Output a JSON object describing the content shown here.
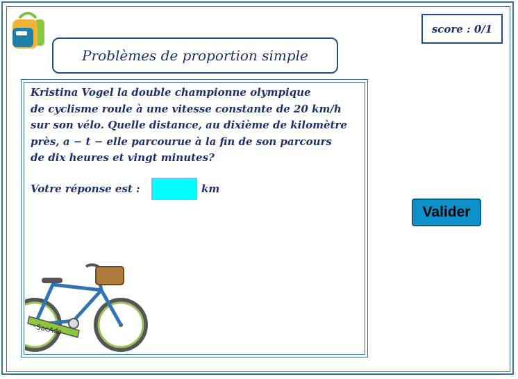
{
  "header": {
    "title": "Problèmes de proportion simple",
    "score": "score : 0/1"
  },
  "question": {
    "text": "Kristina Vogel la double championne olympique de cyclisme roule à une vitesse constante de 20 km/h sur son vélo. Quelle distance, au dixième de kilomètre près, a−t−elle parcourue à la fin de son parcours de dix heures et vingt minutes?",
    "lines": [
      "Kristina Vogel la double championne olympique",
      "de cyclisme roule à une vitesse constante de 20 km/h",
      "sur son vélo. Quelle distance, au dixième de kilomètre",
      "près, a − t − elle parcourue à la fin de son parcours",
      "de dix heures et vingt minutes?"
    ]
  },
  "answer": {
    "label": "Votre réponse est :",
    "value": "",
    "unit": "km"
  },
  "actions": {
    "validate_label": "Valider"
  },
  "illustration": {
    "bike_label": "SacAdo"
  },
  "colors": {
    "frame": "#3a6f96",
    "text": "#1e2f6f",
    "input_bg": "#00ffff",
    "button_bg": "#0d8fc9"
  }
}
